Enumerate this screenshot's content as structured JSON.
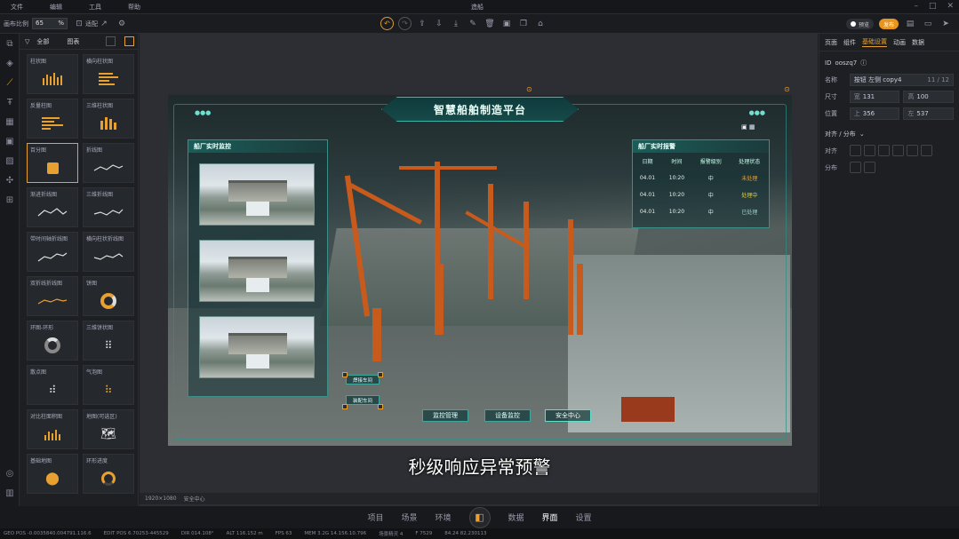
{
  "menu": {
    "items": [
      "文件",
      "编辑",
      "工具",
      "帮助"
    ],
    "title": "造船"
  },
  "toolbar": {
    "ratio_label": "画布比例",
    "ratio_value": "65",
    "ratio_unit": "%",
    "auto_label": "适配"
  },
  "toolbar_right": {
    "preview": "预览",
    "publish": "发布"
  },
  "library": {
    "tab_all": "全部",
    "tab_chart": "图表",
    "cards": [
      "柱状图",
      "横向柱状图",
      "反量柱图",
      "三维柱状图",
      "百分图",
      "折线图",
      "渐进折线图",
      "三维折线图",
      "带时间轴折线图",
      "横向柱状折线图",
      "双折线折线图",
      "饼图",
      "环图-环形",
      "三维饼状图",
      "散点图",
      "气泡图",
      "对比柱面积图",
      "地图(可选区)",
      "基础地图",
      "环形进度"
    ]
  },
  "scene": {
    "title": "智慧船舶制造平台",
    "left_panel_title": "船厂实时监控",
    "right_panel_title": "船厂实时报警",
    "table_headers": [
      "日期",
      "时间",
      "报警级别",
      "处理状态"
    ],
    "table_rows": [
      [
        "04.01",
        "10:20",
        "中",
        "未处理"
      ],
      [
        "04.01",
        "10:20",
        "中",
        "处理中"
      ],
      [
        "04.01",
        "10:20",
        "中",
        "已处理"
      ]
    ],
    "tags": [
      "焊接车间",
      "装配车间"
    ],
    "buttons": [
      "监控管理",
      "设备监控",
      "安全中心"
    ]
  },
  "subtitle": "秒级响应异常预警",
  "right_panel": {
    "tabs": [
      "页面",
      "组件",
      "基础设置",
      "动画",
      "数据"
    ],
    "id_label": "ID",
    "id_value": "ooszq7",
    "name_label": "名称",
    "name_value": "按钮 左侧 copy4",
    "name_count": "11 / 12",
    "size_label": "尺寸",
    "width_label": "宽",
    "width_value": "131",
    "height_label": "高",
    "height_value": "100",
    "pos_label": "位置",
    "top_label": "上",
    "top_value": "356",
    "left_label": "左",
    "left_value": "537",
    "align_section": "对齐 / 分布",
    "align_label": "对齐",
    "dist_label": "分布"
  },
  "statusbar": {
    "resolution": "1920×1080",
    "center": "安全中心"
  },
  "bottomnav": {
    "items": [
      "项目",
      "场景",
      "环境",
      "数据",
      "界面",
      "设置"
    ]
  },
  "footer": {
    "items": [
      "GEO POS  -0.0035840.004791.116.6",
      "EDIT POS  6.70253-445529",
      "DIR  014.108°",
      "ALT  116.152 m",
      "FPS  63",
      "MEM  3.2G  14.156.10.796",
      "场景精灵  4",
      "F 7529",
      "84.24  82.230113"
    ]
  }
}
